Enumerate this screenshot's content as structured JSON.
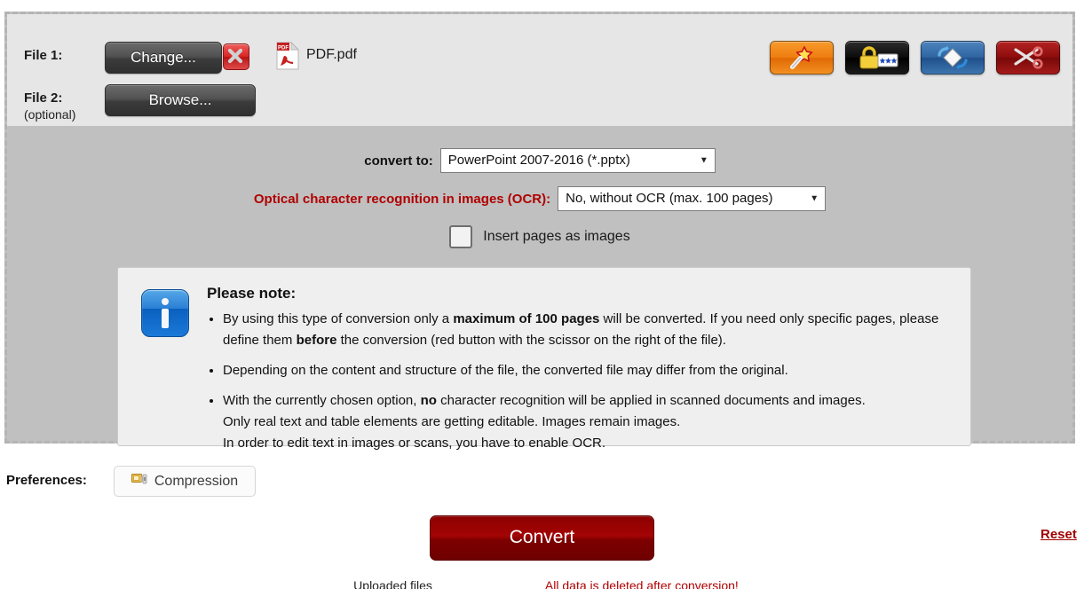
{
  "file_section": {
    "file1": {
      "label": "File 1:",
      "change_button": "Change...",
      "remove_icon": "close-icon",
      "file_icon": "pdf-file-icon",
      "file_name": "PDF.pdf"
    },
    "file2": {
      "label": "File 2:",
      "sublabel": "(optional)",
      "browse_button": "Browse..."
    },
    "tools": [
      {
        "name": "magic-wand-icon",
        "color": "#ef7d10",
        "title": "Improve / repair PDF"
      },
      {
        "name": "lock-password-icon",
        "color": "#000000",
        "title": "Protect PDF with password"
      },
      {
        "name": "rotate-icon",
        "color": "#2d63a0",
        "title": "Rotate pages"
      },
      {
        "name": "scissors-icon",
        "color": "#8d0d0d",
        "title": "Select page range"
      }
    ]
  },
  "options": {
    "convert_to_label": "convert to:",
    "convert_to_value": "PowerPoint 2007-2016 (*.pptx)",
    "ocr_label": "Optical character recognition in images (OCR):",
    "ocr_value": "No, without OCR (max. 100 pages)",
    "ocr_label_color": "#b00000",
    "insert_pages_label": "Insert pages as images",
    "insert_pages_checked": false
  },
  "note": {
    "icon": "info-icon",
    "title": "Please note:",
    "bullets": [
      {
        "parts": [
          {
            "text": "By using this type of conversion only a ",
            "bold": false
          },
          {
            "text": "maximum of 100 pages",
            "bold": true
          },
          {
            "text": " will be converted. If you need only specific pages, please define them ",
            "bold": false
          },
          {
            "text": "before",
            "bold": true
          },
          {
            "text": " the conversion (red button with the scissor on the right of the file).",
            "bold": false
          }
        ]
      },
      {
        "parts": [
          {
            "text": "Depending on the content and structure of the file, the converted file may differ from the original.",
            "bold": false
          }
        ]
      },
      {
        "parts": [
          {
            "text": "With the currently chosen option, ",
            "bold": false
          },
          {
            "text": "no",
            "bold": true
          },
          {
            "text": " character recognition will be applied in scanned documents and images.",
            "bold": false
          },
          {
            "text": "\nOnly real text and table elements are getting editable. Images remain images.",
            "bold": false
          },
          {
            "text": "\nIn order to edit text in images or scans, you have to enable OCR.",
            "bold": false
          }
        ]
      }
    ]
  },
  "bottom": {
    "preferences_label": "Preferences:",
    "compression_button": "Compression",
    "compression_icon": "compressed-file-icon",
    "convert_button": "Convert",
    "convert_button_color": "#8c0000",
    "reset_link": "Reset",
    "reset_link_color": "#a00000",
    "footer_left": "Uploaded files",
    "footer_right": "All data is deleted after conversion!"
  }
}
